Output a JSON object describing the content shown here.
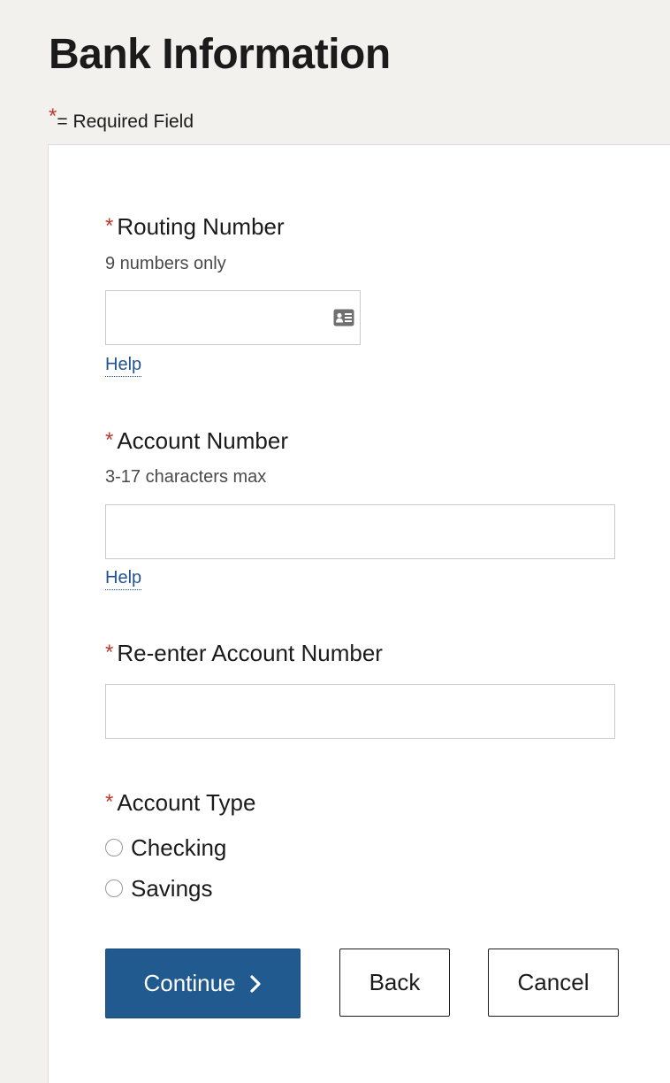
{
  "page": {
    "title": "Bank Information",
    "required_star": "*",
    "required_note": "= Required Field"
  },
  "form": {
    "routing": {
      "star": "*",
      "label": "Routing Number",
      "hint": "9 numbers only",
      "value": "",
      "icon": "contact-card-icon",
      "help": "Help"
    },
    "account": {
      "star": "*",
      "label": "Account Number",
      "hint": "3-17 characters max",
      "value": "",
      "help": "Help"
    },
    "reenter": {
      "star": "*",
      "label": "Re-enter Account Number",
      "value": ""
    },
    "account_type": {
      "star": "*",
      "label": "Account Type",
      "options": [
        {
          "label": "Checking",
          "selected": false
        },
        {
          "label": "Savings",
          "selected": false
        }
      ]
    }
  },
  "buttons": {
    "continue": "Continue",
    "back": "Back",
    "cancel": "Cancel"
  },
  "colors": {
    "background": "#f2f1ee",
    "required_star": "#c0392b",
    "link": "#205493",
    "primary_button": "#215a8e"
  }
}
